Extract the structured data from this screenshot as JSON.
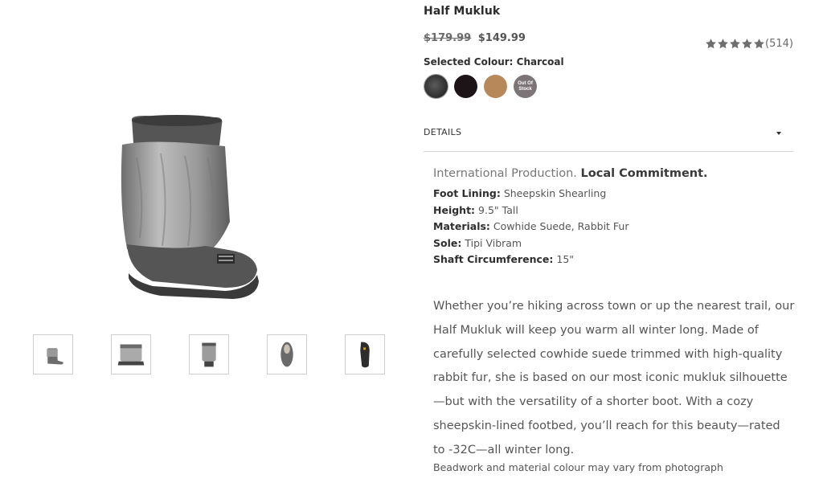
{
  "product": {
    "title": "Half Mukluk",
    "price_original": "$179.99",
    "price_sale": "$149.99",
    "rating": {
      "stars": 5,
      "count_label": "(514)"
    },
    "selected_colour_label": "Selected Colour: Charcoal",
    "swatches": [
      {
        "name": "Charcoal",
        "color": "#3a3a3a",
        "selected": true
      },
      {
        "name": "Black",
        "color": "#1c1416",
        "selected": false
      },
      {
        "name": "Tan",
        "color": "#b7885a",
        "selected": false
      },
      {
        "name": "Grey",
        "color": "#7c7477",
        "out_of_stock": true,
        "badge": "Out Of Stock"
      }
    ]
  },
  "details": {
    "label": "DETAILS",
    "tagline_prefix": "International Production.",
    "tagline_bold": "Local Commitment.",
    "specs": [
      {
        "key": "Foot Lining:",
        "value": "Sheepskin Shearling"
      },
      {
        "key": "Height:",
        "value": "9.5\" Tall"
      },
      {
        "key": "Materials:",
        "value": "Cowhide Suede, Rabbit Fur"
      },
      {
        "key": "Sole:",
        "value": "Tipi Vibram"
      },
      {
        "key": "Shaft Circumference:",
        "value": "15\""
      }
    ],
    "description": "Whether you’re hiking across town or up the nearest trail, our Half Mukluk will keep you warm all winter long. Made of carefully selected cowhide suede trimmed with high-quality rabbit fur, she is based on our most iconic mukluk silhouette —but with the versatility of a shorter boot. With  a cozy sheepskin-lined footbed, you’ll reach for this beauty—rated to -32C—all winter long.",
    "disclaimer": "Beadwork and material colour may vary from photograph"
  },
  "gallery": {
    "thumbnails": [
      "side-view",
      "front-view",
      "back-view",
      "top-view",
      "sole-view"
    ]
  },
  "colors": {
    "star": "#6e6e6e",
    "divider": "#d8d8d8"
  }
}
